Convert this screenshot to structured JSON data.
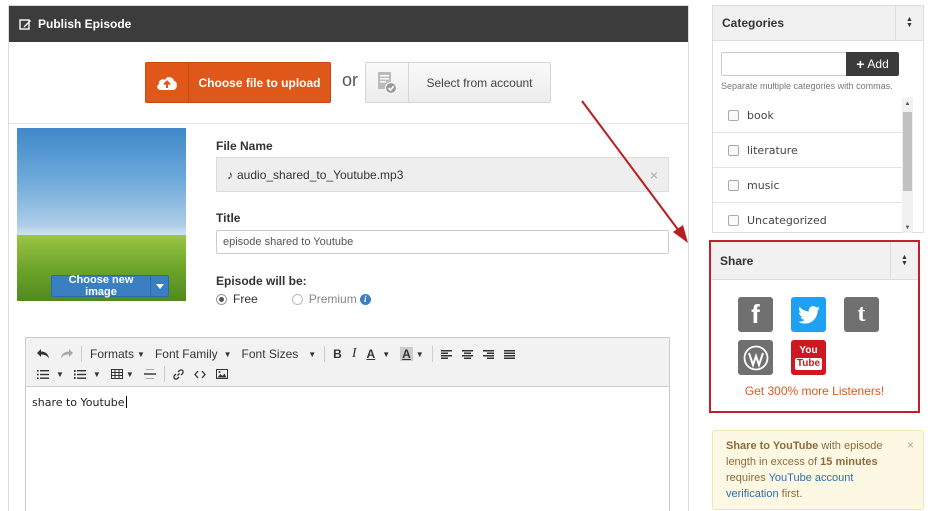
{
  "main": {
    "title": "Publish Episode",
    "upload": {
      "choose_label": "Choose file to upload",
      "or_label": "or",
      "select_label": "Select from account"
    },
    "cover": {
      "choose_new_image_label": "Choose new image"
    },
    "file_name": {
      "label": "File Name",
      "value": "audio_shared_to_Youtube.mp3",
      "clear": "×"
    },
    "title_field": {
      "label": "Title",
      "value": "episode shared to Youtube"
    },
    "episode": {
      "label": "Episode will be:",
      "options": [
        {
          "label": "Free",
          "selected": true
        },
        {
          "label": "Premium",
          "selected": false
        }
      ],
      "info": "i"
    },
    "editor": {
      "toolbar_row1": {
        "formats": "Formats",
        "font_family": "Font Family",
        "font_sizes": "Font Sizes",
        "bold": "B",
        "italic": "I",
        "font_color": "A",
        "bg_color": "A"
      },
      "content": "share to Youtube"
    }
  },
  "categories": {
    "title": "Categories",
    "add_label": "Add",
    "hint": "Separate multiple categories with commas.",
    "items": [
      {
        "label": "book",
        "checked": false
      },
      {
        "label": "literature",
        "checked": false
      },
      {
        "label": "music",
        "checked": false
      },
      {
        "label": "Uncategorized",
        "checked": false
      }
    ]
  },
  "share": {
    "title": "Share",
    "icons": [
      "facebook-icon",
      "twitter-icon",
      "tumblr-icon",
      "wordpress-icon",
      "youtube-icon"
    ],
    "youtube_text_top": "You",
    "youtube_text_bottom": "Tube",
    "cta": "Get 300% more Listeners!"
  },
  "alert": {
    "part1": "Share to YouTube",
    "part2": " with episode length in excess of ",
    "part3": "15 minutes",
    "part4": " requires ",
    "link": "YouTube account verification",
    "part5": " first.",
    "close": "×"
  },
  "colors": {
    "header_bg": "#3c3c3c",
    "accent_orange": "#e0571a",
    "primary_blue": "#3a7fc1",
    "highlight_red": "#c0202a",
    "twitter_blue": "#1da1f2",
    "youtube_red": "#cc181e",
    "social_grey": "#707070"
  }
}
